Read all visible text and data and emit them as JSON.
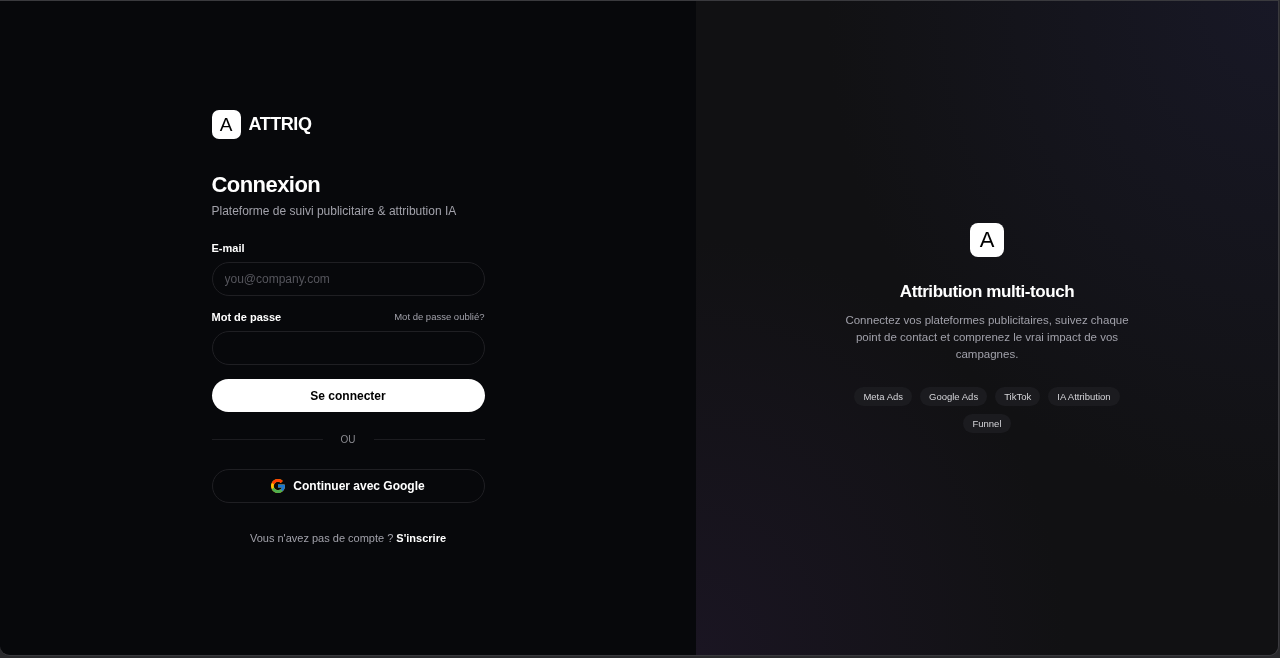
{
  "brand": {
    "mark": "A",
    "name": "ATTRIQ"
  },
  "login": {
    "title": "Connexion",
    "subtitle": "Plateforme de suivi publicitaire & attribution IA",
    "fields": [
      {
        "label": "E-mail",
        "placeholder": "you@company.com"
      },
      {
        "label": "Mot de passe",
        "link": "Mot de passe oublié?"
      }
    ],
    "submit": "Se connecter",
    "divider": "OU",
    "google_button": "Continuer avec Google",
    "signup": {
      "text": "Vous n'avez pas de compte ?",
      "link": "S'inscrire"
    }
  },
  "showcase": {
    "mark": "A",
    "title": "Attribution multi-touch",
    "description": "Connectez vos plateformes publicitaires, suivez chaque point de contact et comprenez le vrai impact de vos campagnes.",
    "tags": [
      "Meta Ads",
      "Google Ads",
      "TikTok",
      "IA Attribution",
      "Funnel"
    ]
  }
}
